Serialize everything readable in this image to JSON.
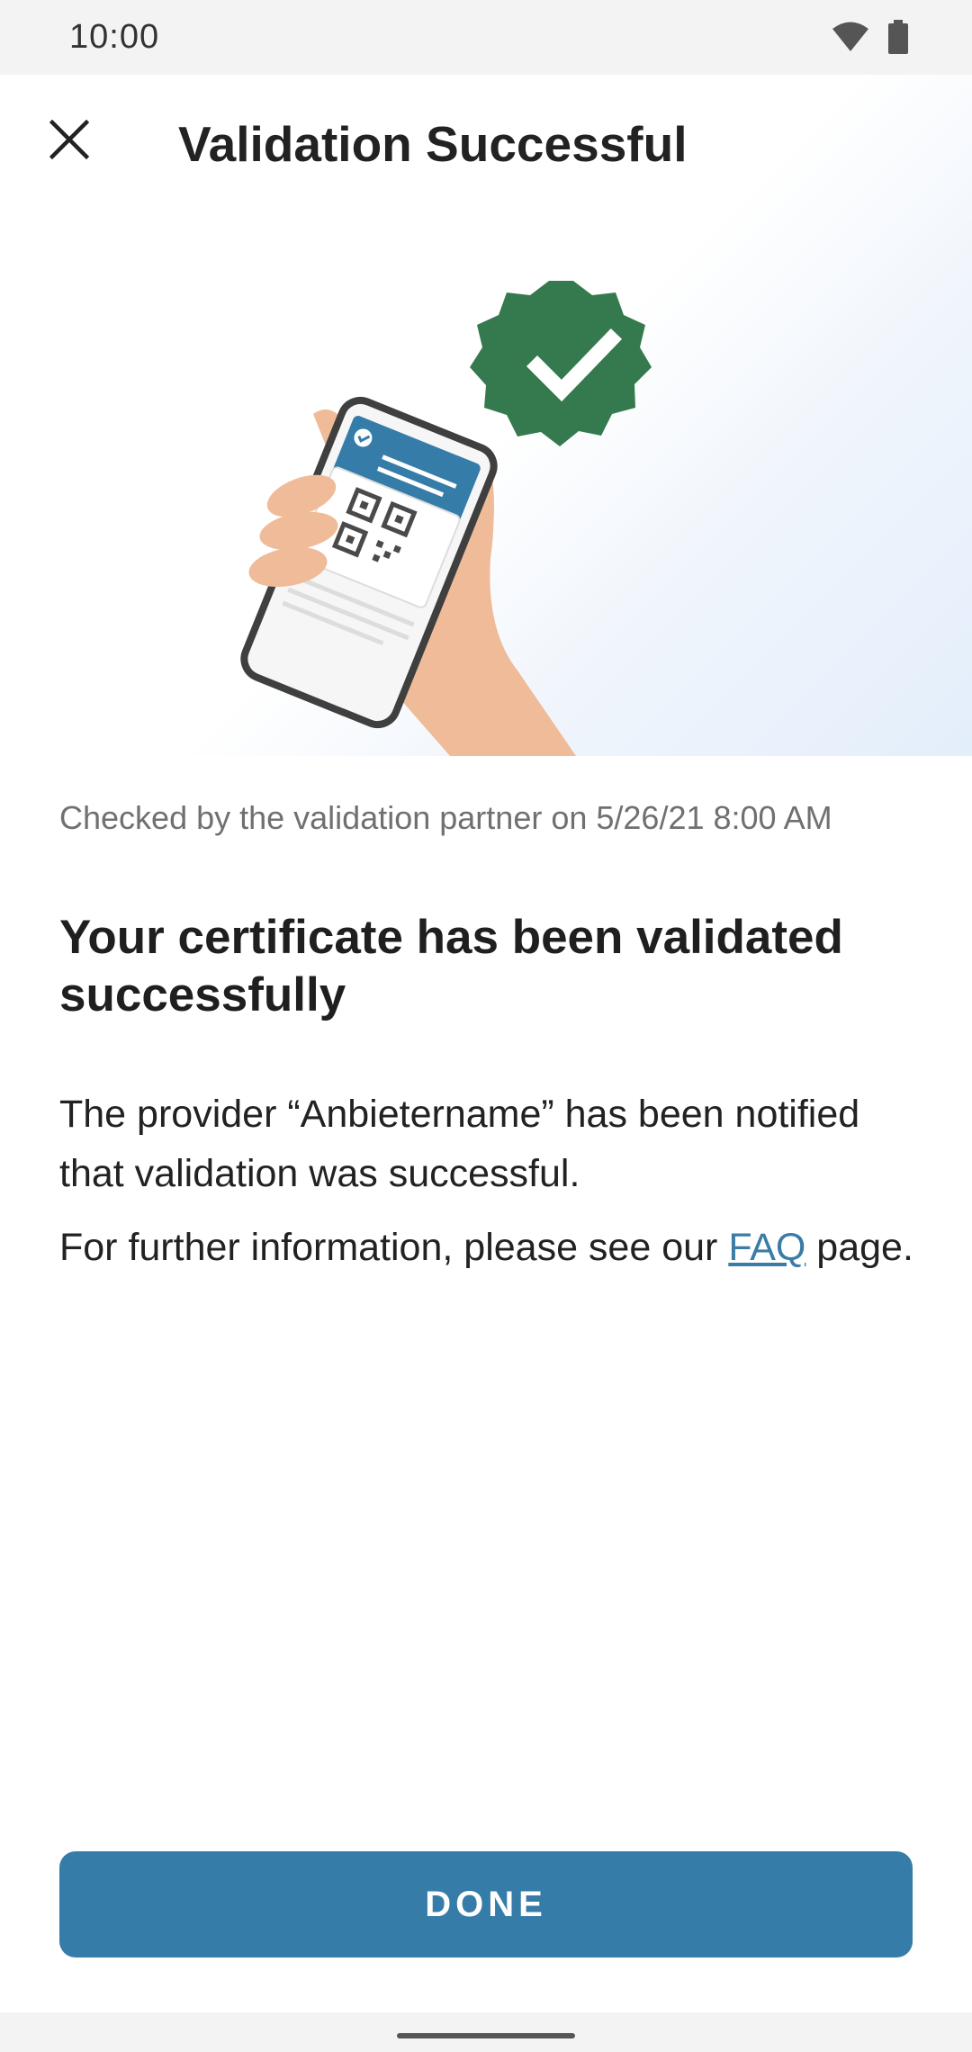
{
  "status_bar": {
    "time": "10:00",
    "icons": [
      "wifi-icon",
      "battery-icon"
    ]
  },
  "header": {
    "close_icon": "close-icon",
    "title": "Validation Successful"
  },
  "illustration": {
    "icons": [
      "hand-holding-phone-illustration",
      "verified-badge-icon",
      "qr-code-icon"
    ],
    "colors": {
      "badge": "#357a4e",
      "phone_card": "#357ca9",
      "skin": "#efbb98"
    }
  },
  "content": {
    "checked_by": "Checked by the validation partner on 5/26/21 8:00 AM",
    "heading": "Your certificate has been validated successfully",
    "paragraph1": "The provider “Anbietername” has been notified that validation was successful.",
    "paragraph2_prefix": "For further information, please see our ",
    "faq_link": "FAQ",
    "paragraph2_suffix": " page."
  },
  "actions": {
    "done_label": "DONE"
  },
  "colors": {
    "primary": "#357ca9",
    "link": "#3a7ca8",
    "text": "#222222",
    "muted": "#707070"
  }
}
